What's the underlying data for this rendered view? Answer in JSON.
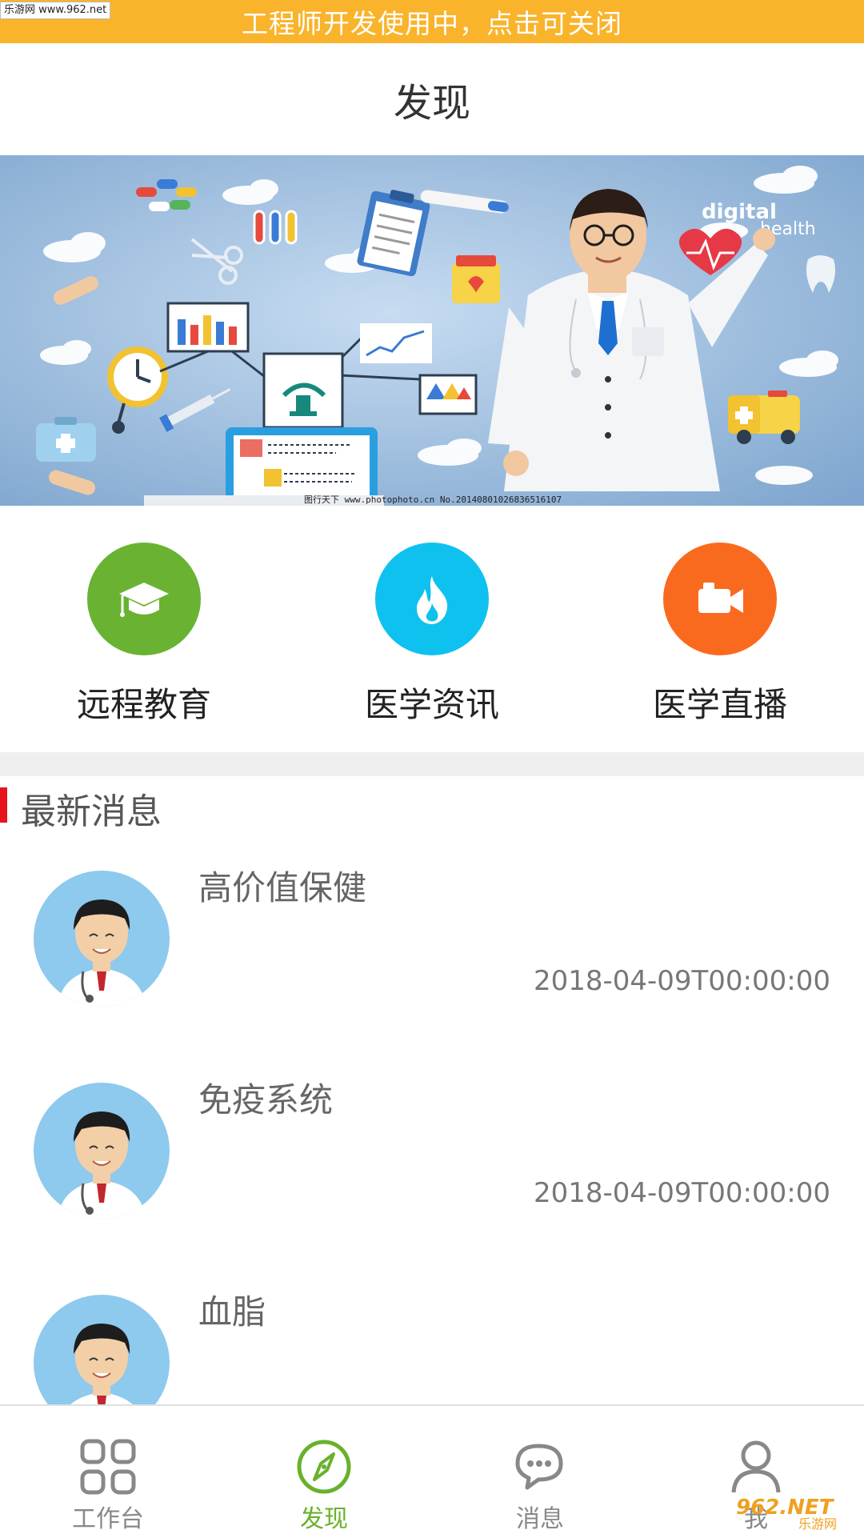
{
  "watermark_top": "乐游网 www.962.net",
  "dev_notice": "工程师开发使用中，点击可关闭",
  "page_title": "发现",
  "hero": {
    "text_line1": "digital",
    "text_line2": "health",
    "credit": "图行天下 www.photophoto.cn  No.20140801026836516107"
  },
  "actions": [
    {
      "label": "远程教育",
      "color": "#6ab232",
      "icon": "graduation-cap-icon"
    },
    {
      "label": "医学资讯",
      "color": "#0fc1ee",
      "icon": "flame-icon"
    },
    {
      "label": "医学直播",
      "color": "#fa6a1e",
      "icon": "video-camera-icon"
    }
  ],
  "section": {
    "title": "最新消息",
    "accent": "#e8141c"
  },
  "news": [
    {
      "title": "高价值保健",
      "date": "2018-04-09T00:00:00"
    },
    {
      "title": "免疫系统",
      "date": "2018-04-09T00:00:00"
    },
    {
      "title": "血脂",
      "date": ""
    }
  ],
  "tabs": [
    {
      "label": "工作台",
      "icon": "grid-icon"
    },
    {
      "label": "发现",
      "icon": "compass-icon",
      "active": true
    },
    {
      "label": "消息",
      "icon": "chat-bubble-icon"
    },
    {
      "label": "我",
      "icon": "person-icon"
    }
  ],
  "colors": {
    "dev_bar": "#f9b42b",
    "active_tab": "#6ab12b",
    "avatar_bg": "#8ec9ee"
  },
  "watermark_br": {
    "brand": "962.NET",
    "cn": "乐游网"
  }
}
